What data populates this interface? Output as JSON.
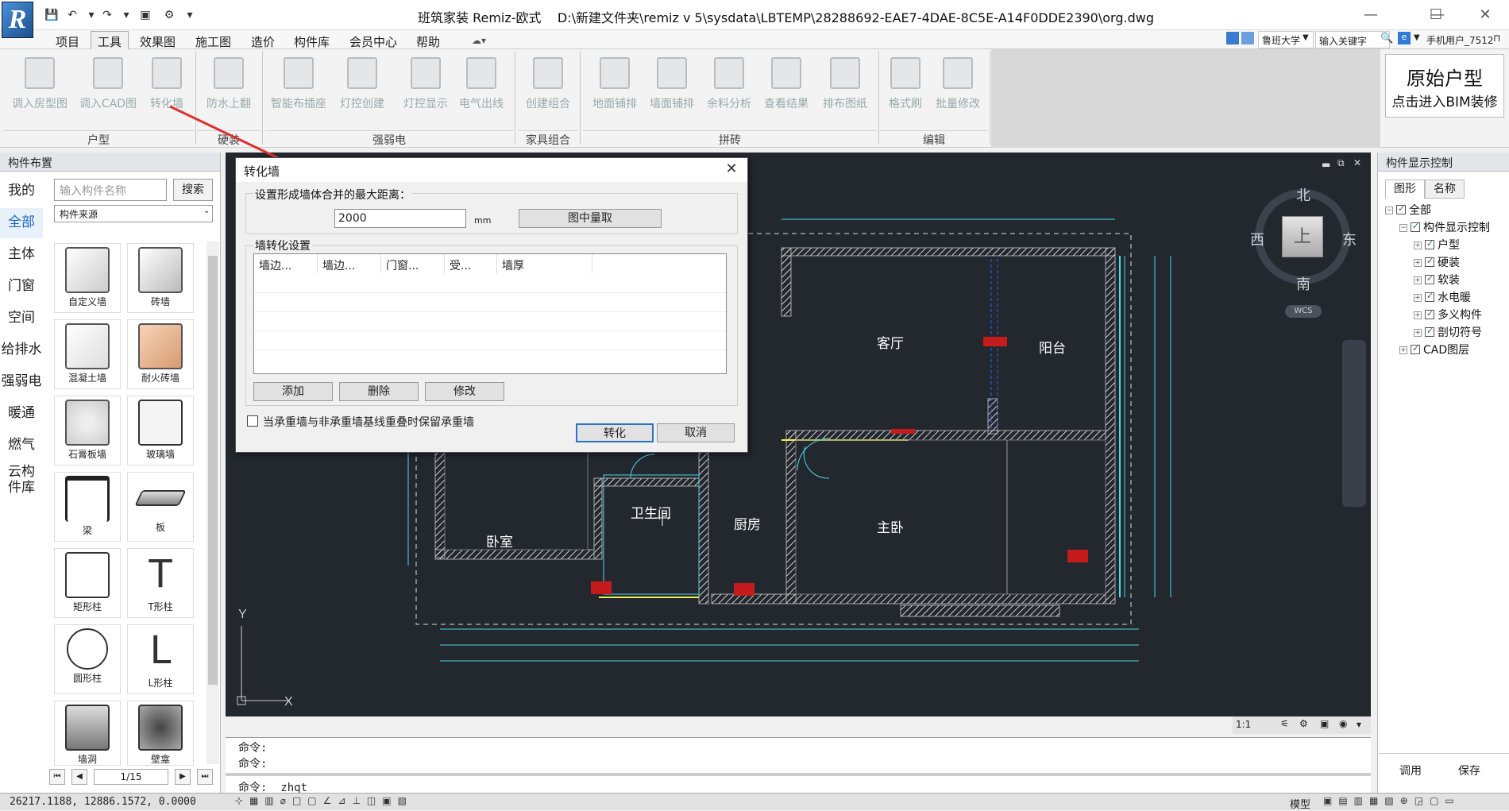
{
  "titlebar": {
    "logo": "R",
    "title": "班筑家装 Remiz-欧式    D:\\新建文件夹\\remiz v 5\\sysdata\\LBTEMP\\28288692-EAE7-4DAE-8C5E-A14F0DDE2390\\org.dwg"
  },
  "menu": {
    "items": [
      "项目",
      "工具",
      "效果图",
      "施工图",
      "造价",
      "构件库",
      "会员中心",
      "帮助"
    ],
    "active": "工具",
    "right": {
      "font_select": "鲁班大学",
      "keyword_placeholder": "输入关键字",
      "user": "手机用户_7512"
    }
  },
  "ribbon": {
    "groups": [
      {
        "label": "户型",
        "buttons": [
          "调入房型图",
          "调入CAD图",
          "转化墙"
        ]
      },
      {
        "label": "硬装",
        "buttons": [
          "防水上翻"
        ]
      },
      {
        "label": "强弱电",
        "buttons": [
          "智能布插座",
          "灯控创建",
          "灯控显示",
          "电气出线"
        ]
      },
      {
        "label": "家具组合",
        "buttons": [
          "创建组合"
        ]
      },
      {
        "label": "拼砖",
        "buttons": [
          "地面铺排",
          "墙面铺排",
          "余料分析",
          "查看结果",
          "排布图纸"
        ]
      },
      {
        "label": "编辑",
        "buttons": [
          "格式刷",
          "批量修改"
        ]
      }
    ],
    "bim": {
      "line1": "原始户型",
      "line2": "点击进入BIM装修"
    }
  },
  "left_panel": {
    "header": "构件布置",
    "search_placeholder": "输入构件名称",
    "search_button": "搜索",
    "source_select": "构件来源",
    "categories": [
      "我的",
      "全部",
      "主体",
      "门窗",
      "空间",
      "给排水",
      "强弱电",
      "暖通",
      "燃气",
      "云构件库"
    ],
    "active_category": "全部",
    "components": [
      "自定义墙",
      "砖墙",
      "混凝土墙",
      "耐火砖墙",
      "石膏板墙",
      "玻璃墙",
      "梁",
      "板",
      "矩形柱",
      "T形柱",
      "圆形柱",
      "L形柱",
      "墙洞",
      "壁龛"
    ],
    "pager": "1/15"
  },
  "cad": {
    "rooms": [
      "客厅",
      "阳台",
      "卫生间",
      "厨房",
      "主卧",
      "卧室"
    ],
    "compass": {
      "n": "北",
      "s": "南",
      "e": "东",
      "w": "西",
      "center": "上",
      "wcs": "WCS"
    },
    "scale": "1:1",
    "axis_y": "Y",
    "axis_x": "X"
  },
  "command": {
    "lines": [
      "命令:",
      "命令:",
      "命令: _zhqt"
    ]
  },
  "status": {
    "coords": "26217.1188, 12886.1572, 0.0000",
    "model": "模型"
  },
  "right_panel": {
    "header": "构件显示控制",
    "tabs": [
      "图形",
      "名称"
    ],
    "tree": [
      {
        "label": "全部",
        "level": 0
      },
      {
        "label": "构件显示控制",
        "level": 1
      },
      {
        "label": "户型",
        "level": 2
      },
      {
        "label": "硬装",
        "level": 2
      },
      {
        "label": "软装",
        "level": 2
      },
      {
        "label": "水电暖",
        "level": 2
      },
      {
        "label": "多义构件",
        "level": 2
      },
      {
        "label": "剖切符号",
        "level": 2
      },
      {
        "label": "CAD图层",
        "level": 1
      }
    ],
    "buttons": [
      "调用",
      "保存"
    ]
  },
  "dialog": {
    "title": "转化墙",
    "distance_label": "设置形成墙体合并的最大距离：",
    "distance_value": "2000",
    "unit": "mm",
    "pick_button": "图中量取",
    "group_label": "墙转化设置",
    "columns": [
      "墙边...",
      "墙边...",
      "门窗...",
      "受...",
      "墙厚"
    ],
    "add_button": "添加",
    "delete_button": "删除",
    "modify_button": "修改",
    "checkbox_label": "当承重墙与非承重墙基线重叠时保留承重墙",
    "convert_button": "转化",
    "cancel_button": "取消"
  },
  "colors": {
    "accent": "#1a66c2",
    "cad_bg": "#23272e",
    "wall": "#9a9a9a",
    "dim": "#4fd6e8",
    "arrow": "#e03030"
  }
}
